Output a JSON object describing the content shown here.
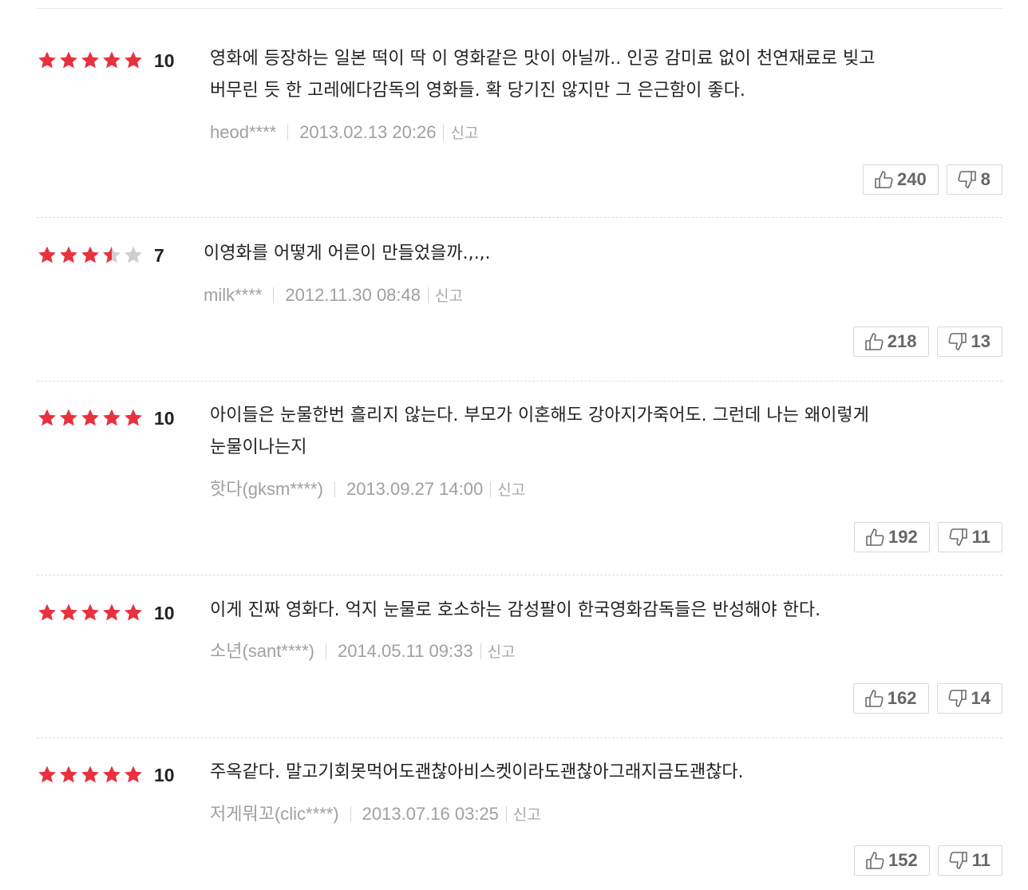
{
  "report_label": "신고",
  "colors": {
    "star_on": "#e8313f",
    "star_off": "#cfcfcf",
    "meta": "#a0a0a0"
  },
  "reviews": [
    {
      "stars": 5,
      "score": "10",
      "text_lines": [
        "영화에 등장하는 일본 떡이 딱 이 영화같은 맛이 아닐까.. 인공 감미료 없이 천연재료로 빚고",
        "버무린 듯 한 고레에다감독의 영화들. 확 당기진 않지만 그 은근함이 좋다."
      ],
      "author": "heod****",
      "date": "2013.02.13 20:26",
      "likes": "240",
      "dislikes": "8"
    },
    {
      "stars": 3.5,
      "score": "7",
      "text_lines": [
        "이영화를 어떻게 어른이 만들었을까.,.,."
      ],
      "author": "milk****",
      "date": "2012.11.30 08:48",
      "likes": "218",
      "dislikes": "13"
    },
    {
      "stars": 5,
      "score": "10",
      "text_lines": [
        "아이들은 눈물한번 흘리지 않는다. 부모가 이혼해도 강아지가죽어도. 그런데 나는 왜이렇게",
        "눈물이나는지"
      ],
      "author": "핫다(gksm****)",
      "date": "2013.09.27 14:00",
      "likes": "192",
      "dislikes": "11"
    },
    {
      "stars": 5,
      "score": "10",
      "text_lines": [
        "이게 진짜 영화다. 억지 눈물로 호소하는 감성팔이 한국영화감독들은 반성해야 한다."
      ],
      "author": "소년(sant****)",
      "date": "2014.05.11 09:33",
      "likes": "162",
      "dislikes": "14"
    },
    {
      "stars": 5,
      "score": "10",
      "text_lines": [
        "주옥같다. 말고기회못먹어도괜찮아비스켓이라도괜찮아그래지금도괜찮다."
      ],
      "author": "저게뭐꼬(clic****)",
      "date": "2013.07.16 03:25",
      "likes": "152",
      "dislikes": "11"
    }
  ]
}
